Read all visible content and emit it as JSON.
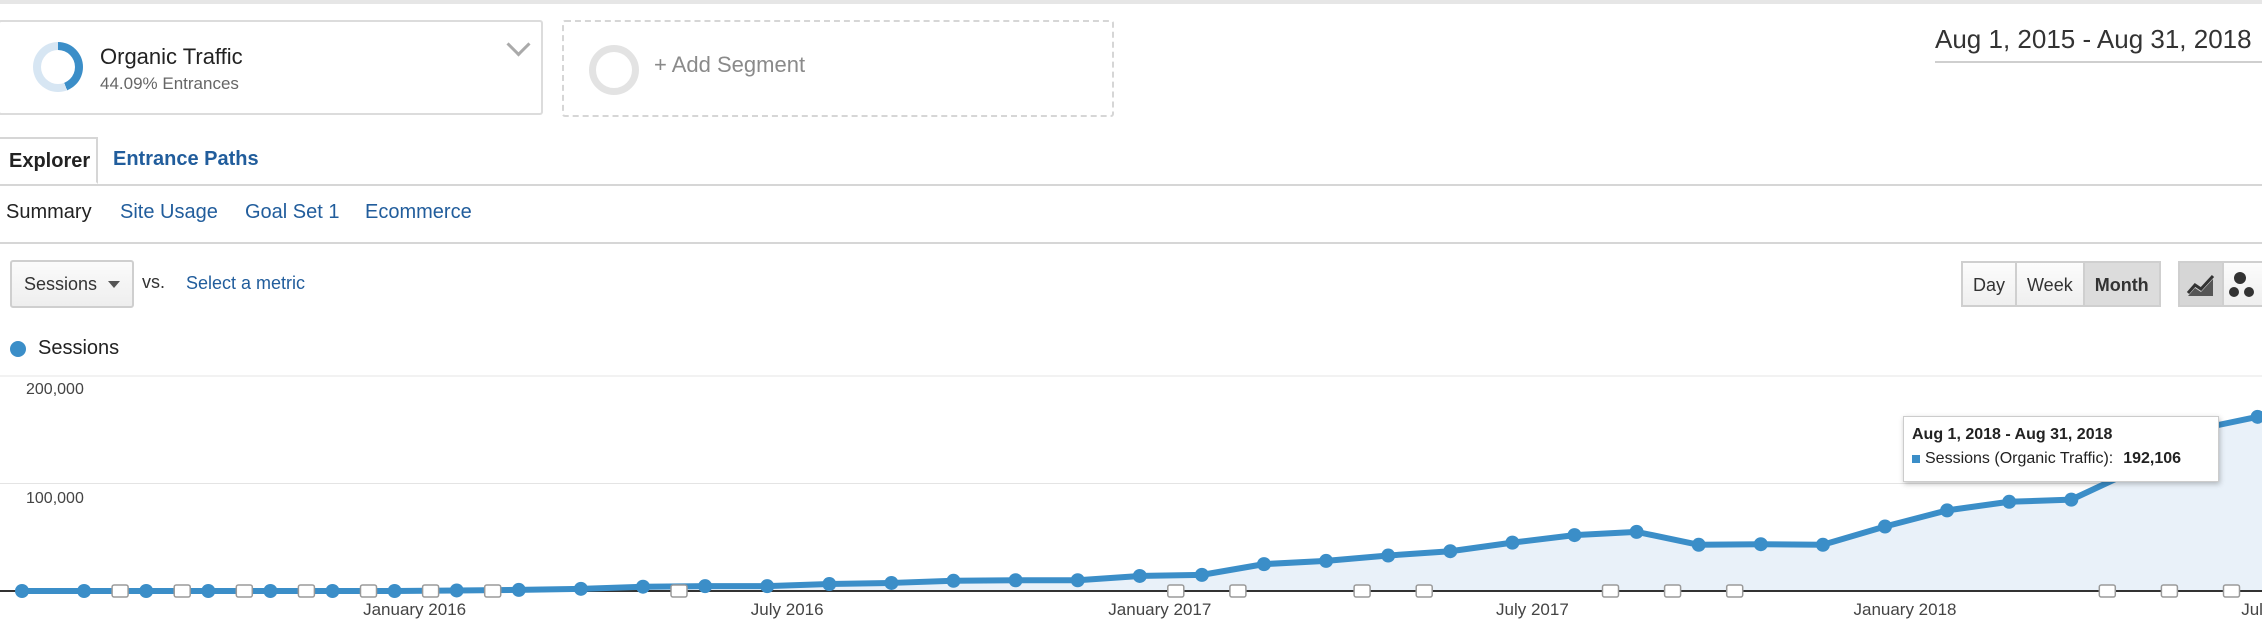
{
  "segments": {
    "active": {
      "title": "Organic Traffic",
      "subtitle": "44.09% Entrances",
      "share": 0.4409
    },
    "add_label": "+ Add Segment"
  },
  "date_range": "Aug 1, 2015 - Aug 31, 2018",
  "tabs": [
    {
      "label": "Explorer",
      "active": true
    },
    {
      "label": "Entrance Paths",
      "active": false
    }
  ],
  "subtabs": [
    {
      "label": "Summary",
      "active": true
    },
    {
      "label": "Site Usage",
      "active": false
    },
    {
      "label": "Goal Set 1",
      "active": false
    },
    {
      "label": "Ecommerce",
      "active": false
    }
  ],
  "metric_selector": {
    "value": "Sessions",
    "vs_label": "vs.",
    "select_label": "Select a metric"
  },
  "granularity": {
    "options": [
      "Day",
      "Week",
      "Month"
    ],
    "selected": "Month"
  },
  "view_modes": [
    "line-chart-icon",
    "motion-chart-icon"
  ],
  "legend": {
    "label": "Sessions",
    "color": "#3b8ec8"
  },
  "tooltip": {
    "title": "Aug 1, 2018 - Aug 31, 2018",
    "series_label": "Sessions (Organic Traffic):",
    "value": "192,106"
  },
  "chart_data": {
    "type": "area",
    "series": [
      {
        "name": "Sessions",
        "x": [
          "2015-07",
          "2015-08",
          "2015-09",
          "2015-10",
          "2015-11",
          "2015-12",
          "2016-01",
          "2016-02",
          "2016-03",
          "2016-04",
          "2016-05",
          "2016-06",
          "2016-07",
          "2016-08",
          "2016-09",
          "2016-10",
          "2016-11",
          "2016-12",
          "2017-01",
          "2017-02",
          "2017-03",
          "2017-04",
          "2017-05",
          "2017-06",
          "2017-07",
          "2017-08",
          "2017-09",
          "2017-10",
          "2017-11",
          "2017-12",
          "2018-01",
          "2018-02",
          "2018-03",
          "2018-04",
          "2018-05",
          "2018-06",
          "2018-07",
          "2018-08"
        ],
        "values": [
          0,
          0,
          0,
          0,
          0,
          0,
          0,
          500,
          1000,
          2000,
          4000,
          4500,
          4500,
          6500,
          7500,
          9500,
          10000,
          10000,
          14000,
          15000,
          25000,
          28000,
          33000,
          37000,
          45000,
          52000,
          55000,
          43000,
          43500,
          43000,
          60000,
          75000,
          83000,
          85000,
          112000,
          150000,
          162000,
          192106
        ]
      }
    ],
    "x_tick_labels": [
      {
        "x": "2016-01",
        "label": "January 2016"
      },
      {
        "x": "2016-07",
        "label": "July 2016"
      },
      {
        "x": "2017-01",
        "label": "January 2017"
      },
      {
        "x": "2017-07",
        "label": "July 2017"
      },
      {
        "x": "2018-01",
        "label": "January 2018"
      },
      {
        "x": "2018-07",
        "label": "July 2018"
      }
    ],
    "y_ticks": [
      100000,
      200000
    ],
    "y_tick_labels": [
      "100,000",
      "200,000"
    ],
    "ylim": [
      0,
      200000
    ],
    "annotation_months": [
      "2015-08",
      "2015-09",
      "2015-10",
      "2015-11",
      "2015-12",
      "2016-01",
      "2016-02",
      "2016-05",
      "2017-01",
      "2017-02",
      "2017-04",
      "2017-05",
      "2017-08",
      "2017-09",
      "2017-10",
      "2018-04",
      "2018-05",
      "2018-06",
      "2018-07",
      "2018-08"
    ],
    "colors": {
      "line": "#3b8ec8",
      "fill": "#e9f1f9",
      "grid": "#e4e4e4",
      "axis": "#333333"
    }
  }
}
